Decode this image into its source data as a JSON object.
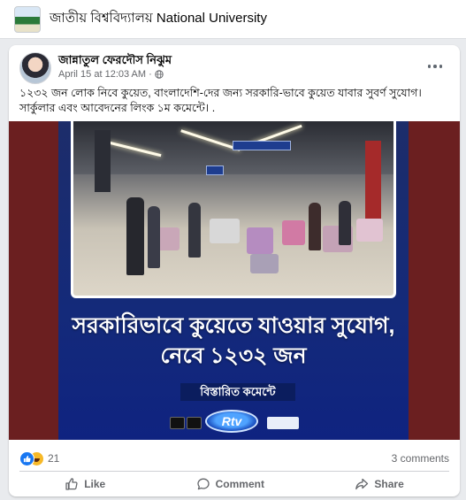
{
  "group": {
    "name": "জাতীয় বিশ্ববিদ্যালয় National University"
  },
  "post": {
    "author": "জান্নাতুল ফেরদৌস নিঝুম",
    "timestamp": "April 15 at 12:03 AM",
    "separator": "·",
    "text_line1": "১২৩২ জন লোক নিবে কুয়েত, বাংলাদেশি-দের জন্য সরকারি-ভাবে কুয়েত যাবার সুবর্ণ সুযোগ।",
    "text_line2": "সার্কুলার এবং আবেদনের লিংক ১ম কমেন্টে। ."
  },
  "media": {
    "headline_line1": "সরকারিভাবে কুয়েতে যাওয়ার সুযোগ,",
    "headline_line2": "নেবে ১২৩২ জন",
    "details_label": "বিস্তারিত কমেন্টে",
    "logo_text": "Rtv"
  },
  "stats": {
    "reaction_count": "21",
    "comments_label": "3 comments"
  },
  "actions": {
    "like": "Like",
    "comment": "Comment",
    "share": "Share"
  },
  "colors": {
    "accent": "#1877f2",
    "media_bg": "#142a7a",
    "media_side": "#6b1f20"
  }
}
